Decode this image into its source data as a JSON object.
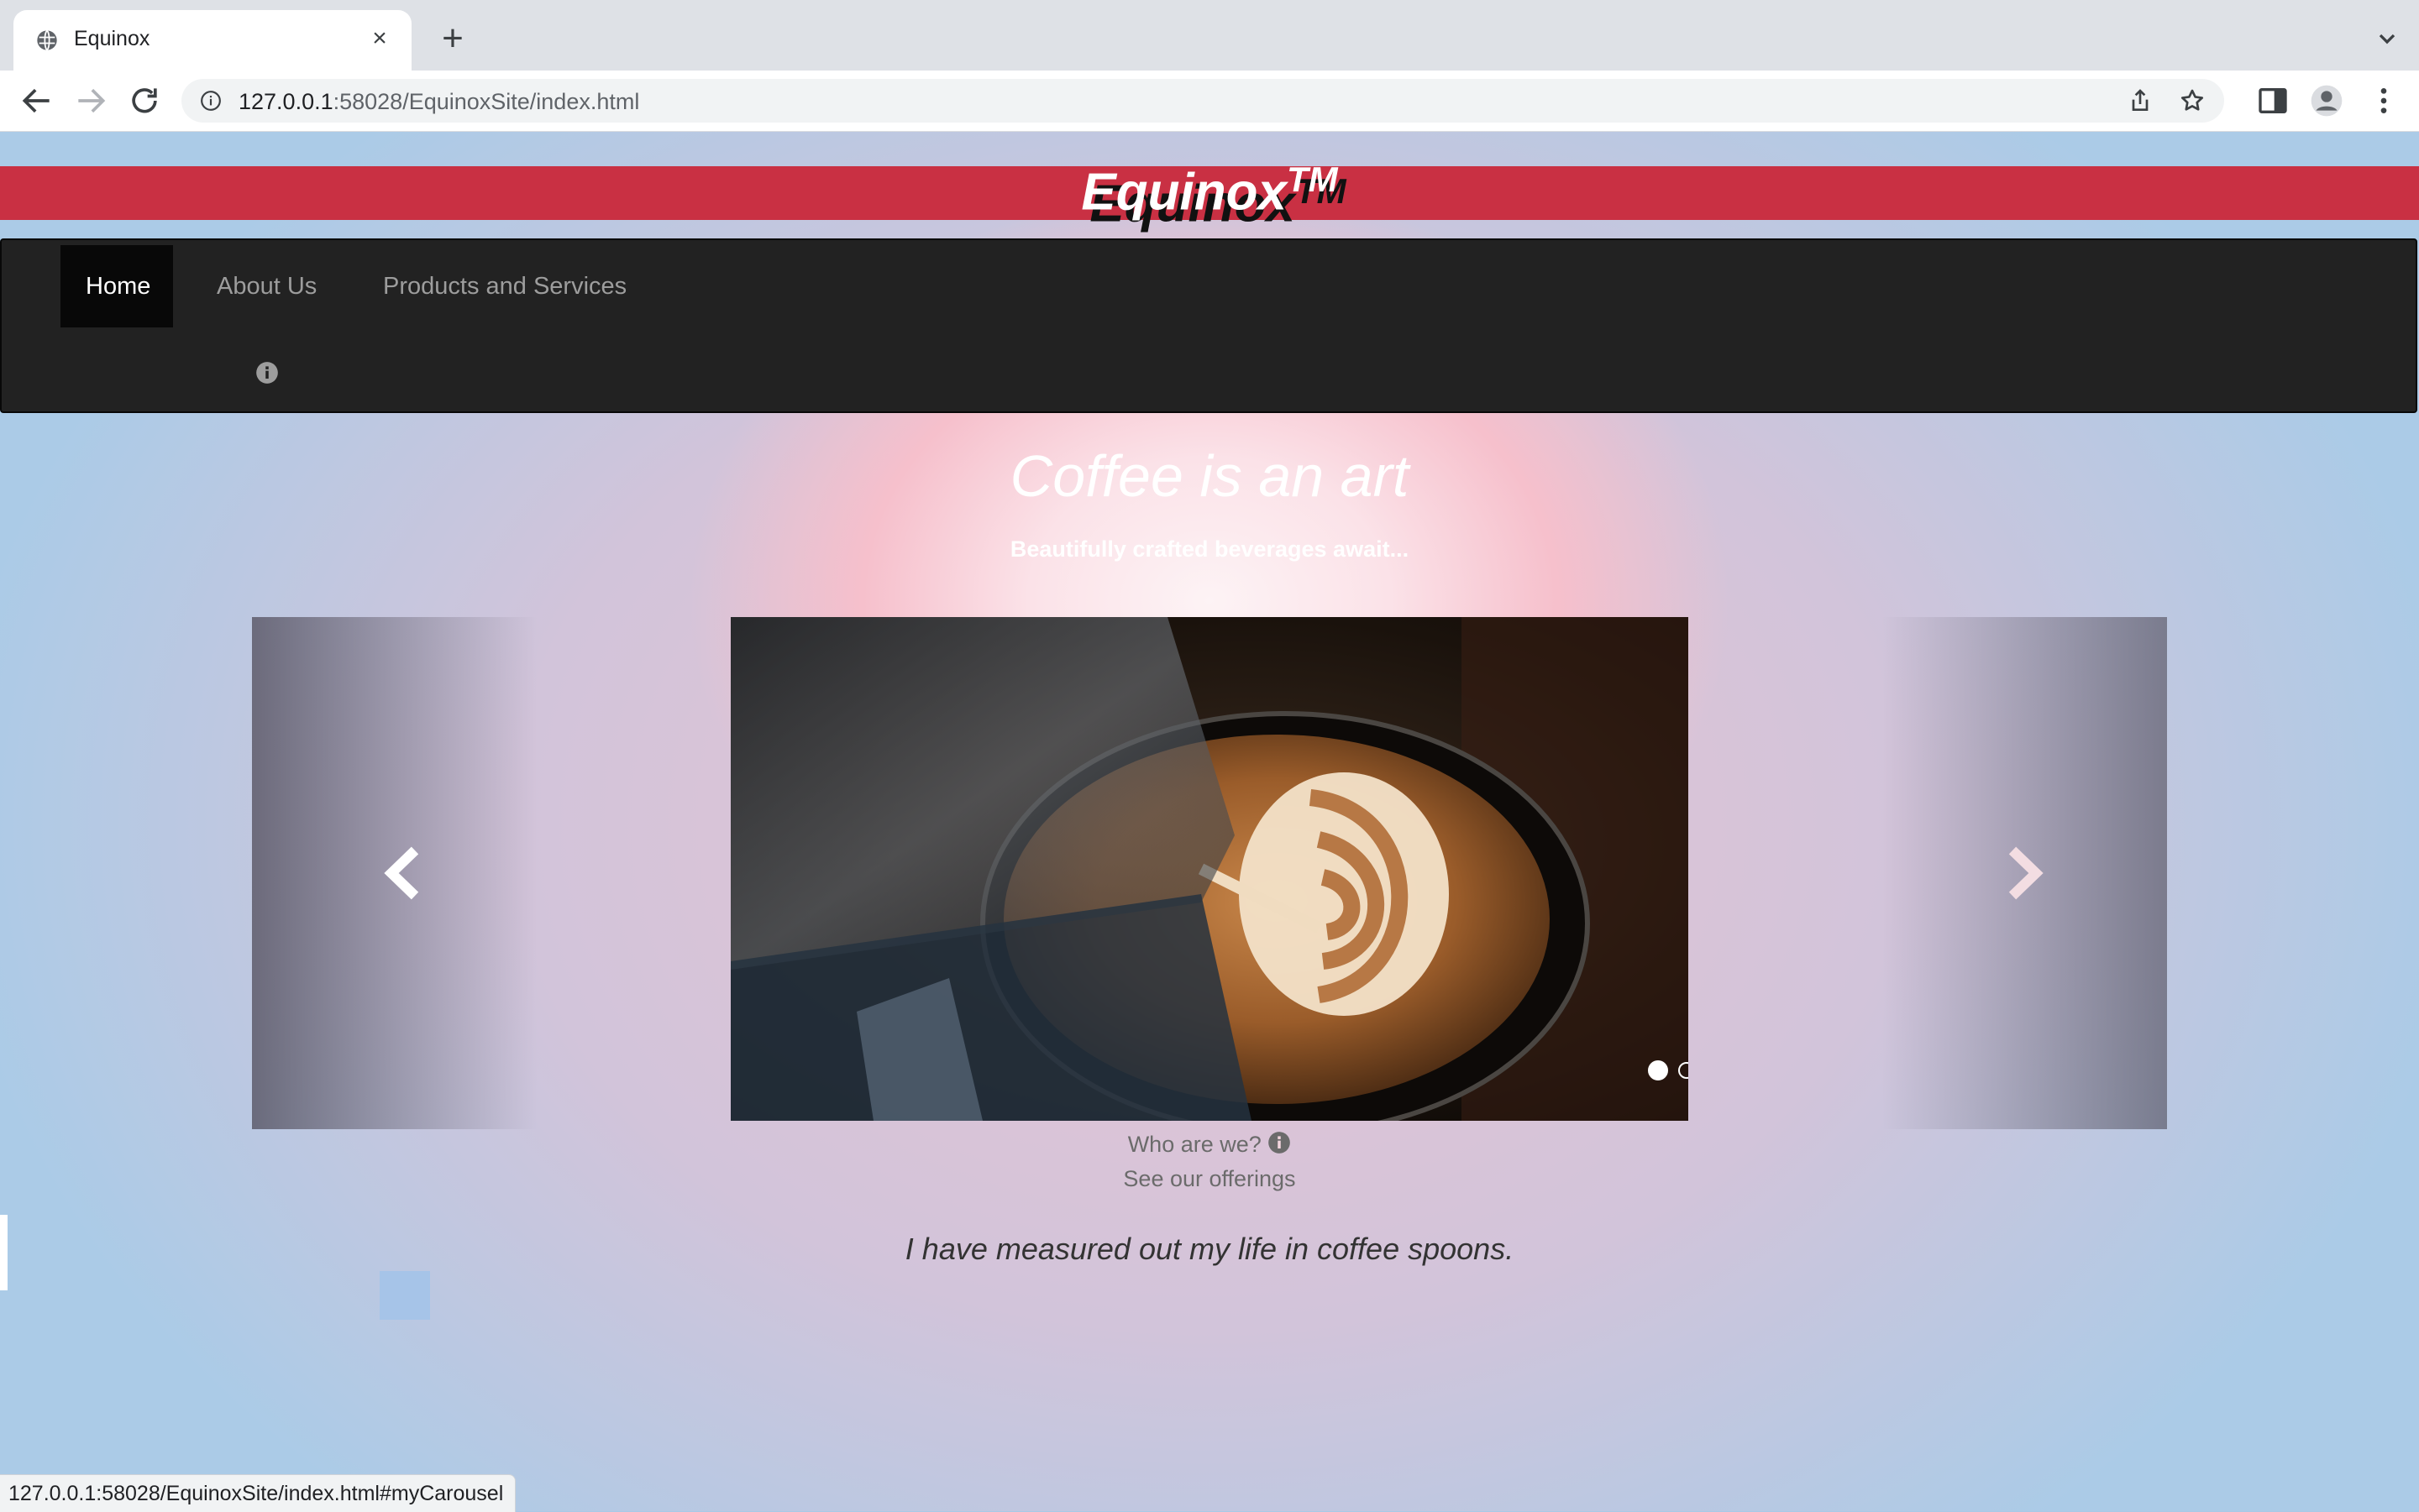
{
  "browser": {
    "tab_title": "Equinox",
    "url_host": "127.0.0.1",
    "url_rest": ":58028/EquinoxSite/index.html",
    "status_url": "127.0.0.1:58028/EquinoxSite/index.html#myCarousel"
  },
  "site": {
    "brand": "Equinox",
    "brand_mark": "TM",
    "nav": {
      "items": [
        {
          "label": "Home",
          "active": true
        },
        {
          "label": "About Us",
          "active": false
        },
        {
          "label": "Products and Services",
          "active": false
        }
      ]
    },
    "hero": {
      "title": "Coffee is an art",
      "subtitle": "Beautifully crafted beverages await..."
    },
    "carousel": {
      "slide_count": 3,
      "active_index": 0
    },
    "links": {
      "who": "Who are we?",
      "offerings": "See our offerings"
    },
    "quote": "I have measured out my life in coffee spoons."
  },
  "colors": {
    "brand_bar": "#c93043",
    "navbar": "#222222",
    "nav_active": "#080808"
  }
}
